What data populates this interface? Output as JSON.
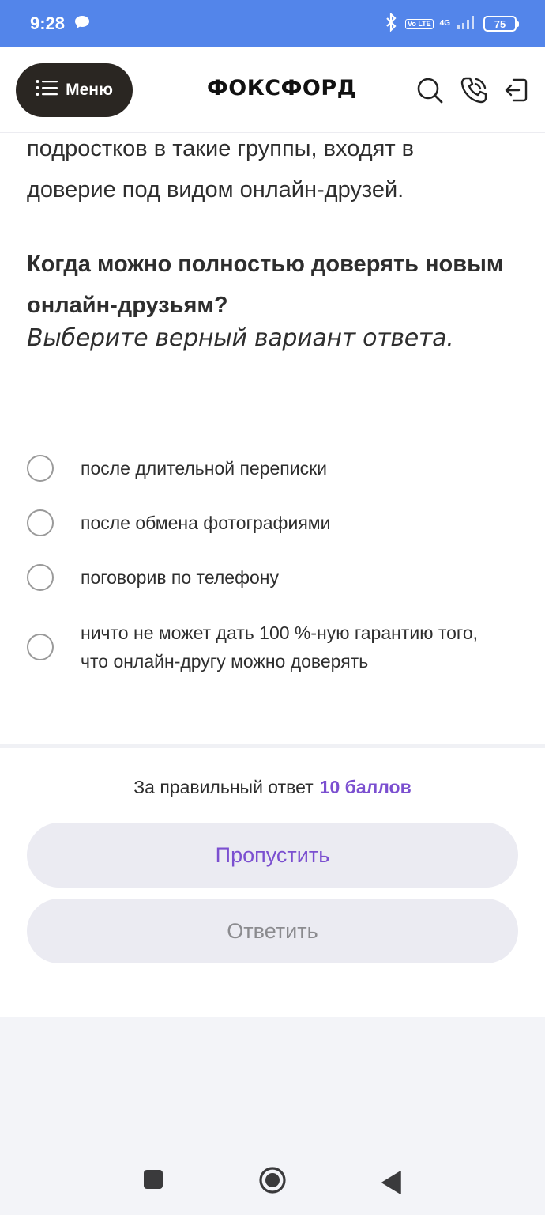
{
  "status_bar": {
    "time": "9:28",
    "volte": "Vo LTE",
    "network": "4G",
    "battery": "75",
    "color": "#5385ea"
  },
  "header": {
    "menu_label": "Меню",
    "logo": "ФОКСФОРД",
    "icons": [
      "search-icon",
      "phone-icon",
      "logout-icon"
    ]
  },
  "content": {
    "intro_text": "подростков в такие группы, входят в доверие под видом онлайн-друзей.",
    "question": "Когда можно полностью доверять новым онлайн-друзьям?",
    "hint": "Выберите верный вариант ответа.",
    "options": [
      "после длительной переписки",
      "после обмена фотографиями",
      "поговорив по телефону",
      "ничто не может дать 100 %-ную гарантию того, что онлайн-другу можно доверять"
    ]
  },
  "footer": {
    "score_label": "За правильный ответ",
    "score_value": "10 баллов",
    "skip_label": "Пропустить",
    "answer_label": "Ответить",
    "accent_color": "#7b4fd0"
  },
  "navbar": {
    "icons": [
      "recents-icon",
      "home-icon",
      "back-icon"
    ]
  }
}
